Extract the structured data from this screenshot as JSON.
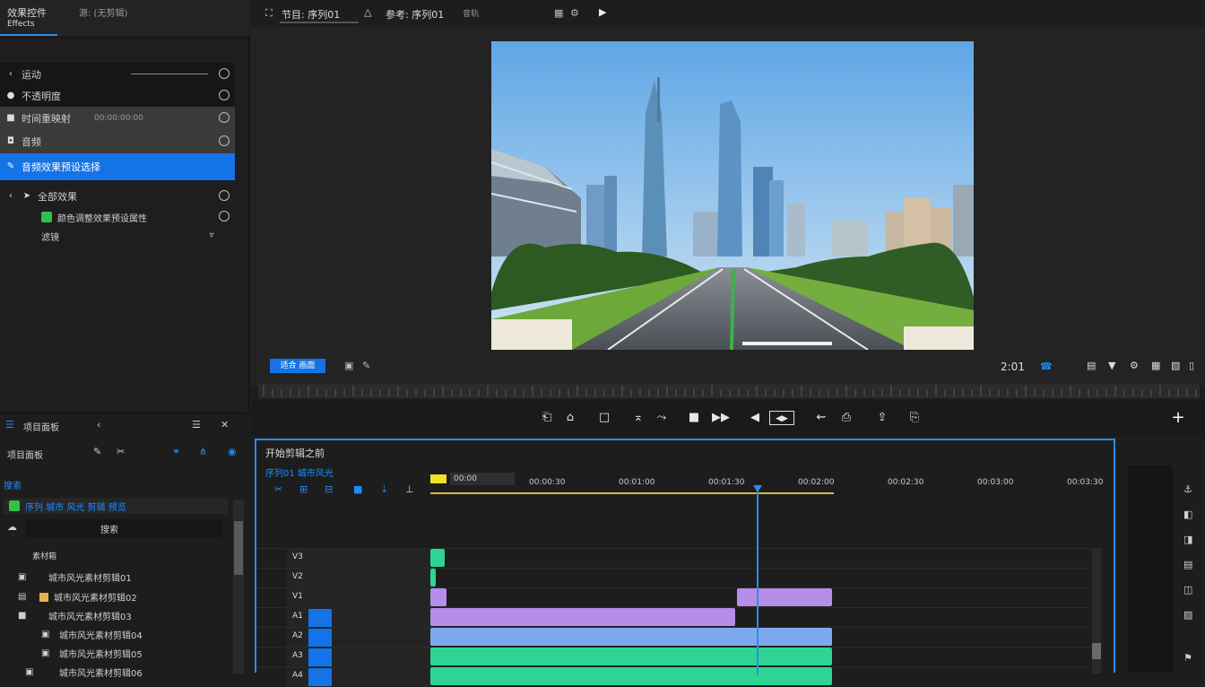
{
  "left_panel": {
    "tabs": [
      {
        "label": "效果控件",
        "sub": "Effects"
      },
      {
        "label": "源: (无剪辑)"
      }
    ],
    "rows": [
      {
        "label": "运动",
        "value": ""
      },
      {
        "label": "不透明度"
      },
      {
        "label": "时间重映射",
        "value": "00:00:00:00"
      },
      {
        "label": "音频"
      },
      {
        "label": "音频效果预设选择"
      },
      {
        "label": "全部效果"
      },
      {
        "label": "颜色调整效果预设属性"
      },
      {
        "label": "滤镜"
      }
    ]
  },
  "program": {
    "tabs": [
      "节目: 序列01",
      "参考: 序列01",
      "音轨"
    ],
    "fit_label": "适合 画面",
    "timecode": "2:01",
    "zoom_label": "1/2"
  },
  "transport": {
    "buttons": [
      "mark-in",
      "mark-out",
      "go-to-in",
      "step-back",
      "play",
      "step-forward",
      "go-to-out",
      "insert",
      "overwrite",
      "export-frame",
      "comparison",
      "add"
    ]
  },
  "project": {
    "header": "项目面板",
    "search_label": "搜索",
    "bin_label": "素材箱",
    "items": [
      {
        "name": "城市风光素材剪辑01"
      },
      {
        "name": "城市风光素材剪辑02"
      },
      {
        "name": "城市风光素材剪辑03"
      },
      {
        "name": "城市风光素材剪辑04"
      },
      {
        "name": "城市风光素材剪辑05"
      },
      {
        "name": "城市风光素材剪辑06"
      }
    ],
    "highlight": "序列 城市 风光 剪辑 预览"
  },
  "timeline": {
    "title": "开始剪辑之前",
    "sequence": "序列01 城市风光",
    "timecode_box": "00:00",
    "ticks": [
      "00:00:00",
      "00:00:30",
      "00:01:00",
      "00:01:30",
      "00:02:00",
      "00:02:30",
      "00:03:00",
      "00:03:30"
    ],
    "tracks": [
      {
        "name": "V3"
      },
      {
        "name": "V2"
      },
      {
        "name": "V1"
      },
      {
        "name": "A1"
      },
      {
        "name": "A2"
      },
      {
        "name": "A3"
      },
      {
        "name": "A4"
      }
    ]
  },
  "colors": {
    "accent": "#1473e6",
    "purple_clip": "#b48ee8",
    "blue_clip": "#7ea9f0",
    "green_clip": "#2fd494"
  }
}
